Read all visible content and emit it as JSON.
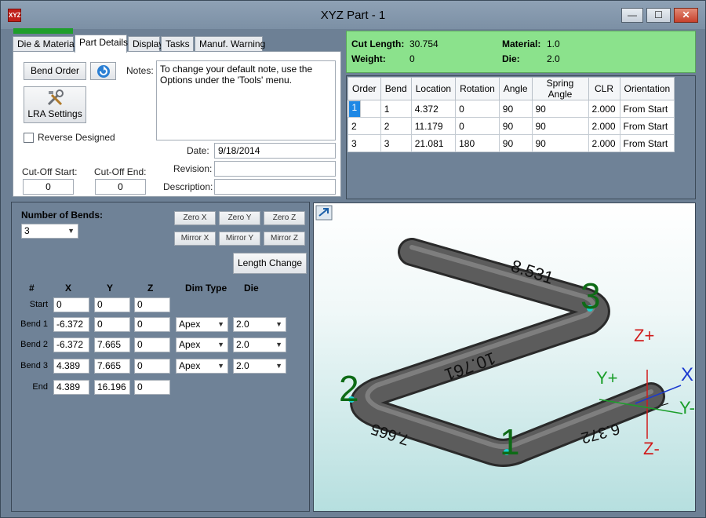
{
  "window": {
    "title": "XYZ Part - 1",
    "app_icon_text": "XYZ",
    "min_glyph": "—",
    "max_glyph": "☐",
    "close_glyph": "✕"
  },
  "tabs": [
    "Die & Material",
    "Part Details",
    "Display",
    "Tasks",
    "Manuf. Warning"
  ],
  "active_tab": "Part Details",
  "part_details": {
    "bend_order_label": "Bend Order",
    "lra_settings_label": "LRA Settings",
    "reverse_designed_label": "Reverse Designed",
    "reverse_designed_checked": false,
    "notes_label": "Notes:",
    "notes_text": "To change your default note, use the Options under the 'Tools' menu.",
    "date_label": "Date:",
    "date_value": "9/18/2014",
    "revision_label": "Revision:",
    "revision_value": "",
    "description_label": "Description:",
    "description_value": "",
    "cutoff_start_label": "Cut-Off Start:",
    "cutoff_start_value": "0",
    "cutoff_end_label": "Cut-Off End:",
    "cutoff_end_value": "0"
  },
  "info": {
    "cut_length_label": "Cut Length:",
    "cut_length_value": "30.754",
    "weight_label": "Weight:",
    "weight_value": "0",
    "material_label": "Material:",
    "material_value": "1.0",
    "die_label": "Die:",
    "die_value": "2.0",
    "color": "#8be28c"
  },
  "bend_table": {
    "columns": [
      "Order",
      "Bend",
      "Location",
      "Rotation",
      "Angle",
      "Spring Angle",
      "CLR",
      "Orientation"
    ],
    "rows": [
      [
        "1",
        "1",
        "4.372",
        "0",
        "90",
        "90",
        "2.000",
        "From Start"
      ],
      [
        "2",
        "2",
        "11.179",
        "0",
        "90",
        "90",
        "2.000",
        "From Start"
      ],
      [
        "3",
        "3",
        "21.081",
        "180",
        "90",
        "90",
        "2.000",
        "From Start"
      ]
    ]
  },
  "coords": {
    "num_bends_label": "Number of Bends:",
    "num_bends_value": "3",
    "zero_x": "Zero X",
    "zero_y": "Zero Y",
    "zero_z": "Zero Z",
    "mirror_x": "Mirror X",
    "mirror_y": "Mirror Y",
    "mirror_z": "Mirror Z",
    "length_change": "Length Change",
    "headers": {
      "num": "#",
      "x": "X",
      "y": "Y",
      "z": "Z",
      "dim_type": "Dim Type",
      "die": "Die"
    },
    "rows": [
      {
        "label": "Start",
        "x": "0",
        "y": "0",
        "z": "0"
      },
      {
        "label": "Bend 1",
        "x": "-6.372",
        "y": "0",
        "z": "0",
        "dim_type": "Apex",
        "die": "2.0"
      },
      {
        "label": "Bend 2",
        "x": "-6.372",
        "y": "7.665",
        "z": "0",
        "dim_type": "Apex",
        "die": "2.0"
      },
      {
        "label": "Bend 3",
        "x": "4.389",
        "y": "7.665",
        "z": "0",
        "dim_type": "Apex",
        "die": "2.0"
      },
      {
        "label": "End",
        "x": "4.389",
        "y": "16.196",
        "z": "0"
      }
    ]
  },
  "view3d": {
    "bend_labels": [
      "1",
      "2",
      "3"
    ],
    "dim_labels": [
      "8.531",
      "10.761",
      "7.665",
      "6.372"
    ],
    "axis_labels": {
      "z_plus": "Z+",
      "z_minus": "Z-",
      "y_plus": "Y+",
      "y_minus": "Y-",
      "x": "X"
    }
  }
}
